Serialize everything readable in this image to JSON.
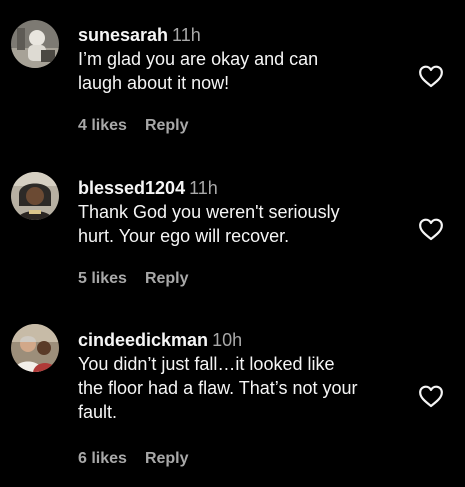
{
  "comments": [
    {
      "username": "sunesarah",
      "time": "11h",
      "lines": [
        "I’m glad you are okay and can",
        "laugh about it now!"
      ],
      "likes": "4 likes",
      "reply": "Reply"
    },
    {
      "username": "blessed1204",
      "time": "11h",
      "lines": [
        "Thank God you weren't seriously",
        "hurt. Your ego will recover."
      ],
      "likes": "5 likes",
      "reply": "Reply"
    },
    {
      "username": "cindeedickman",
      "time": "10h",
      "lines": [
        "You didn’t just fall…it looked like",
        "the floor had a flaw. That’s not your",
        "fault."
      ],
      "likes": "6 likes",
      "reply": "Reply"
    }
  ],
  "colors": {
    "background": "#000000",
    "primary_text": "#f5f5f5",
    "secondary_text": "#a8a8a8"
  },
  "icons": {
    "like": "heart-outline-icon"
  }
}
